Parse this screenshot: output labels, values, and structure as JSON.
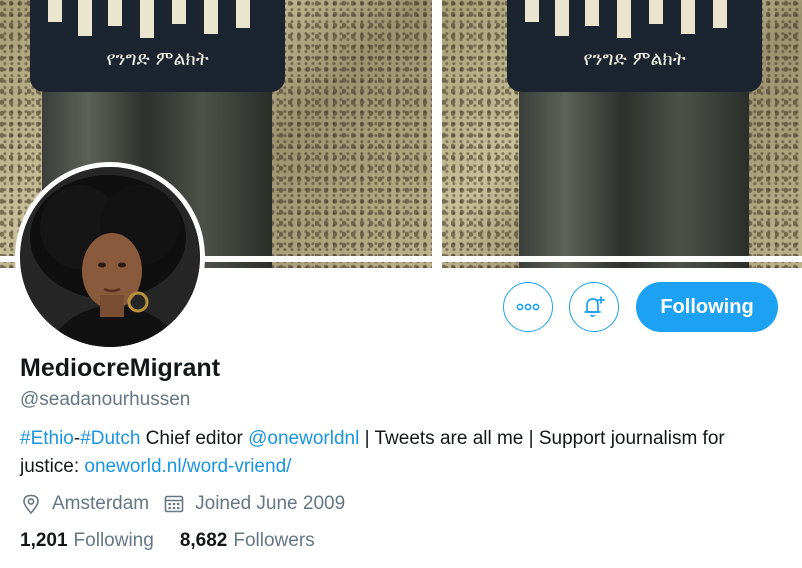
{
  "banner": {
    "amharic_text": "የንግድ ምልክት"
  },
  "profile": {
    "display_name": "MediocreMigrant",
    "handle": "@seadanourhussen",
    "bio": {
      "hashtag1": "#Ethio",
      "sep": "-",
      "hashtag2": "#Dutch",
      "text1": " Chief editor ",
      "mention": "@oneworldnl",
      "text2": " | Tweets are all me | Support journalism for justice: ",
      "link": "oneworld.nl/word-vriend/"
    },
    "location": "Amsterdam",
    "joined": "Joined June 2009"
  },
  "actions": {
    "following_label": "Following",
    "more_icon": "more-dots-icon",
    "notify_icon": "bell-plus-icon"
  },
  "stats": {
    "following_count": "1,201",
    "following_label": "Following",
    "followers_count": "8,682",
    "followers_label": "Followers"
  },
  "colors": {
    "accent": "#1da1f2",
    "link": "#1b95e0",
    "secondary_text": "#657786",
    "primary_text": "#14171a"
  }
}
